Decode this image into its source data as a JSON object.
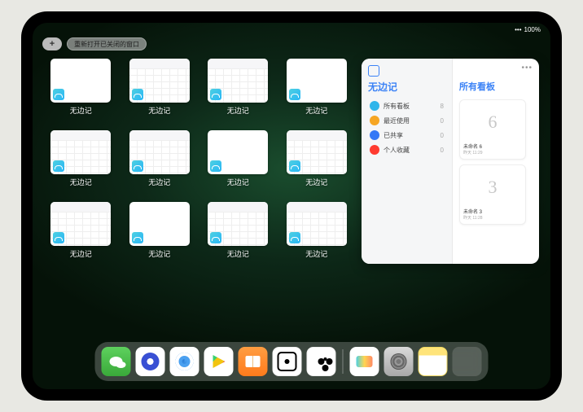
{
  "status": {
    "signal": "•••",
    "battery": "100%"
  },
  "top": {
    "plus": "+",
    "reopen_label": "重新打开已关闭的窗口"
  },
  "tiles": [
    {
      "label": "无边记",
      "variant": "blank"
    },
    {
      "label": "无边记",
      "variant": "sheet"
    },
    {
      "label": "无边记",
      "variant": "sheet"
    },
    {
      "label": "无边记",
      "variant": "blank"
    },
    {
      "label": "无边记",
      "variant": "sheet"
    },
    {
      "label": "无边记",
      "variant": "sheet"
    },
    {
      "label": "无边记",
      "variant": "blank"
    },
    {
      "label": "无边记",
      "variant": "sheet"
    },
    {
      "label": "无边记",
      "variant": "sheet"
    },
    {
      "label": "无边记",
      "variant": "blank"
    },
    {
      "label": "无边记",
      "variant": "sheet"
    },
    {
      "label": "无边记",
      "variant": "sheet"
    }
  ],
  "sidebar": {
    "app_title": "无边记",
    "right_title": "所有看板",
    "more": "•••",
    "nav": [
      {
        "icon_color": "#2fb5ea",
        "label": "所有看板",
        "count": "8"
      },
      {
        "icon_color": "#f6a623",
        "label": "最近使用",
        "count": "0"
      },
      {
        "icon_color": "#3478f6",
        "label": "已共享",
        "count": "0"
      },
      {
        "icon_color": "#ff3b30",
        "label": "个人收藏",
        "count": "0"
      }
    ],
    "boards": [
      {
        "glyph": "6",
        "name": "未命名 6",
        "sub": "昨天 11:29"
      },
      {
        "glyph": "3",
        "name": "未命名 3",
        "sub": "昨天 11:28"
      }
    ]
  },
  "dock": {
    "apps": [
      {
        "name": "wechat"
      },
      {
        "name": "browser-blue"
      },
      {
        "name": "browser-ring"
      },
      {
        "name": "play-store"
      },
      {
        "name": "books"
      },
      {
        "name": "dot-app"
      },
      {
        "name": "pods-app"
      }
    ],
    "recent": [
      {
        "name": "freeform"
      },
      {
        "name": "settings"
      },
      {
        "name": "notes"
      },
      {
        "name": "app-folder"
      }
    ]
  }
}
